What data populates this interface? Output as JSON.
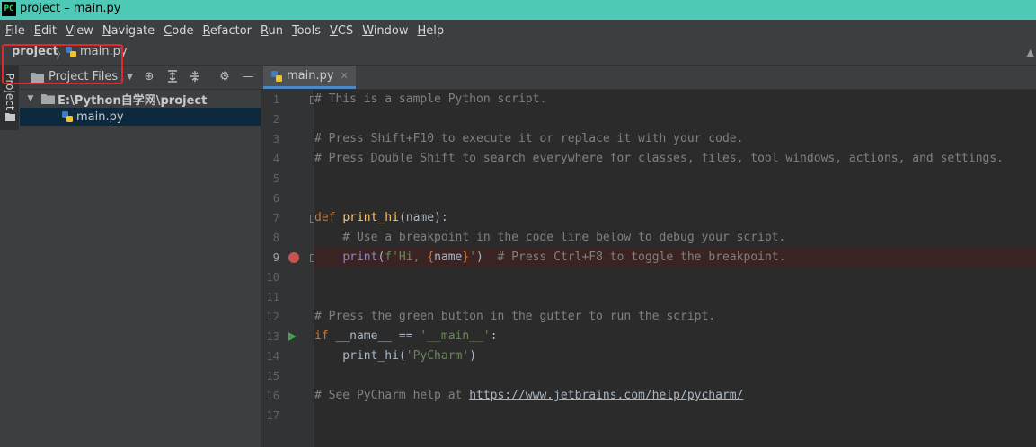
{
  "window": {
    "title": "project – main.py",
    "app_icon": "PC"
  },
  "menubar": {
    "items": [
      {
        "label": "File",
        "mnemonic": "F",
        "rest": "ile"
      },
      {
        "label": "Edit",
        "mnemonic": "E",
        "rest": "dit"
      },
      {
        "label": "View",
        "mnemonic": "V",
        "rest": "iew"
      },
      {
        "label": "Navigate",
        "mnemonic": "N",
        "rest": "avigate"
      },
      {
        "label": "Code",
        "mnemonic": "C",
        "rest": "ode"
      },
      {
        "label": "Refactor",
        "mnemonic": "R",
        "rest": "efactor"
      },
      {
        "label": "Run",
        "mnemonic": "R",
        "rest": "un"
      },
      {
        "label": "Tools",
        "mnemonic": "T",
        "rest": "ools"
      },
      {
        "label": "VCS",
        "mnemonic": "V",
        "rest": "CS"
      },
      {
        "label": "Window",
        "mnemonic": "W",
        "rest": "indow"
      },
      {
        "label": "Help",
        "mnemonic": "H",
        "rest": "elp"
      }
    ]
  },
  "breadcrumb": {
    "project": "project",
    "separator": "〉",
    "file": "main.py"
  },
  "toolstrip": {
    "project_tab": "Project"
  },
  "project_panel": {
    "view_selector": "Project Files",
    "root": "E:\\Python自学网\\project",
    "files": [
      "main.py"
    ]
  },
  "editor": {
    "tab": "main.py",
    "lines": [
      {
        "n": "1"
      },
      {
        "n": "2"
      },
      {
        "n": "3"
      },
      {
        "n": "4"
      },
      {
        "n": "5"
      },
      {
        "n": "6"
      },
      {
        "n": "7"
      },
      {
        "n": "8"
      },
      {
        "n": "9"
      },
      {
        "n": "10"
      },
      {
        "n": "11"
      },
      {
        "n": "12"
      },
      {
        "n": "13"
      },
      {
        "n": "14"
      },
      {
        "n": "15"
      },
      {
        "n": "16"
      },
      {
        "n": "17"
      }
    ],
    "code": {
      "l1": "# This is a sample Python script.",
      "l3": "# Press Shift+F10 to execute it or replace it with your code.",
      "l4": "# Press Double Shift to search everywhere for classes, files, tool windows, actions, and settings.",
      "l7_kw": "def",
      "l7_fn": "print_hi",
      "l7_rest": "(name):",
      "l8": "    # Use a breakpoint in the code line below to debug your script.",
      "l9_indent": "    ",
      "l9_print": "print",
      "l9_open": "(",
      "l9_str1": "f'Hi, ",
      "l9_brace_open": "{",
      "l9_name": "name",
      "l9_brace_close": "}",
      "l9_str2": "'",
      "l9_close": ")",
      "l9_comment": "  # Press Ctrl+F8 to toggle the breakpoint.",
      "l12": "# Press the green button in the gutter to run the script.",
      "l13_kw": "if",
      "l13_mid": " __name__ == ",
      "l13_str": "'__main__'",
      "l13_end": ":",
      "l14_pre": "    print_hi(",
      "l14_str": "'PyCharm'",
      "l14_end": ")",
      "l16_pre": "# See PyCharm help at ",
      "l16_url": "https://www.jetbrains.com/help/pycharm/"
    }
  },
  "colors": {
    "title_bar": "#4ec9b6",
    "breakpoint": "#c75450",
    "run_marker": "#499c54",
    "highlight_box": "#e5262b"
  }
}
